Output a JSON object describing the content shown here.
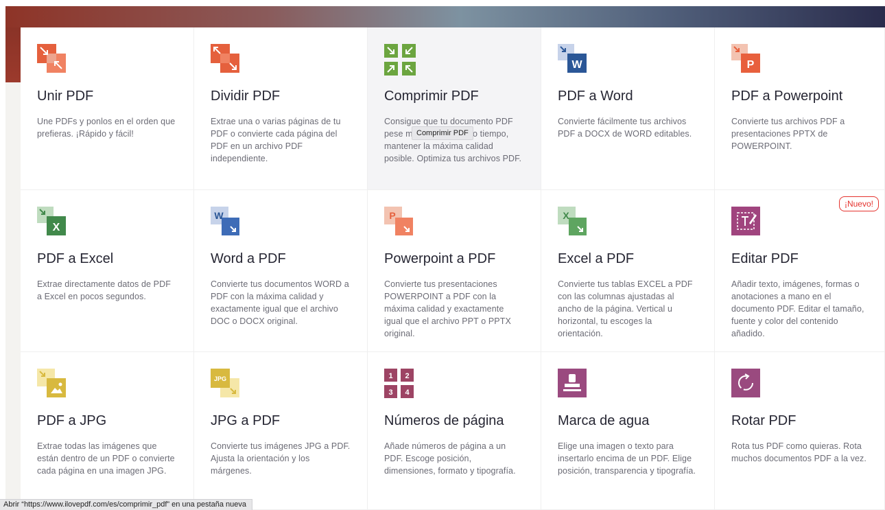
{
  "tools": [
    {
      "title": "Unir PDF",
      "description": "Une PDFs y ponlos en el orden que prefieras. ¡Rápido y fácil!",
      "icon": "merge-icon",
      "color": "#e5603d"
    },
    {
      "title": "Dividir PDF",
      "description": "Extrae una o varias páginas de tu PDF o convierte cada página del PDF en un archivo PDF independiente.",
      "icon": "split-icon",
      "color": "#e5603d"
    },
    {
      "title": "Comprimir PDF",
      "description": "Consigue que tu documento PDF pese menos y, al mismo tiempo, mantener la máxima calidad posible. Optimiza tus archivos PDF.",
      "icon": "compress-icon",
      "color": "#6ca540"
    },
    {
      "title": "PDF a Word",
      "description": "Convierte fácilmente tus archivos PDF a DOCX de WORD editables.",
      "icon": "pdf-to-word-icon",
      "color": "#2b5797",
      "letter": "W"
    },
    {
      "title": "PDF a Powerpoint",
      "description": "Convierte tus archivos PDF a presentaciones PPTX de POWERPOINT.",
      "icon": "pdf-to-powerpoint-icon",
      "color": "#e8603d",
      "letter": "P"
    },
    {
      "title": "PDF a Excel",
      "description": "Extrae directamente datos de PDF a Excel en pocos segundos.",
      "icon": "pdf-to-excel-icon",
      "color": "#41894b",
      "letter": "X"
    },
    {
      "title": "Word a PDF",
      "description": "Convierte tus documentos WORD a PDF con la máxima calidad y exactamente igual que el archivo DOC o DOCX original.",
      "icon": "word-to-pdf-icon",
      "color": "#2b5797",
      "letter": "W"
    },
    {
      "title": "Powerpoint a PDF",
      "description": "Convierte tus presentaciones POWERPOINT a PDF con la máxima calidad y exactamente igual que el archivo PPT o PPTX original.",
      "icon": "powerpoint-to-pdf-icon",
      "color": "#e8603d",
      "letter": "P"
    },
    {
      "title": "Excel a PDF",
      "description": "Convierte tus tablas EXCEL a PDF con las columnas ajustadas al ancho de la página. Vertical u horizontal, tu escoges la orientación.",
      "icon": "excel-to-pdf-icon",
      "color": "#41894b",
      "letter": "X"
    },
    {
      "title": "Editar PDF",
      "description": "Añadir texto, imágenes, formas o anotaciones a mano en el documento PDF. Editar el tamaño, fuente y color del contenido añadido.",
      "icon": "edit-pdf-icon",
      "color": "#a0447e",
      "badge": "¡Nuevo!"
    },
    {
      "title": "PDF a JPG",
      "description": "Extrae todas las imágenes que están dentro de un PDF o convierte cada página en una imagen JPG.",
      "icon": "pdf-to-jpg-icon",
      "color": "#d8b93f"
    },
    {
      "title": "JPG a PDF",
      "description": "Convierte tus imágenes JPG a PDF. Ajusta la orientación y los márgenes.",
      "icon": "jpg-to-pdf-icon",
      "color": "#d8b93f",
      "letter": "JPG"
    },
    {
      "title": "Números de página",
      "description": "Añade números de página a un PDF. Escoge posición, dimensiones, formato y tipografía.",
      "icon": "page-numbers-icon",
      "color": "#9d4464",
      "digits": [
        "1",
        "2",
        "3",
        "4"
      ]
    },
    {
      "title": "Marca de agua",
      "description": "Elige una imagen o texto para insertarlo encima de un PDF. Elige posición, transparencia y tipografía.",
      "icon": "watermark-icon",
      "color": "#9a4a7f"
    },
    {
      "title": "Rotar PDF",
      "description": "Rota tus PDF como quieras. Rota muchos documentos PDF a la vez.",
      "icon": "rotate-icon",
      "color": "#9a4a7f"
    }
  ],
  "tooltip": "Comprimir PDF",
  "status_bar": "Abrir “https://www.ilovepdf.com/es/comprimir_pdf” en una pestaña nueva"
}
